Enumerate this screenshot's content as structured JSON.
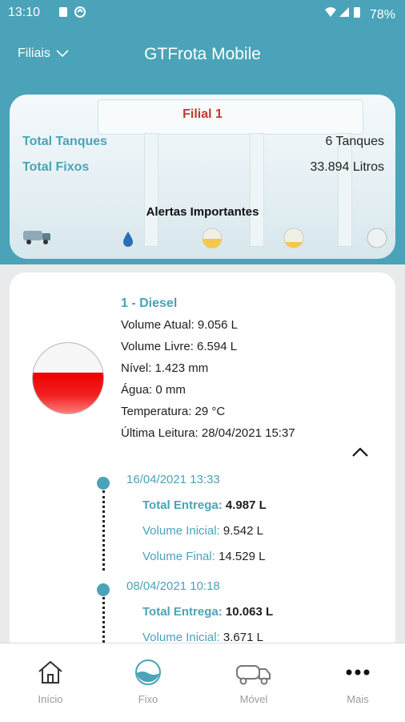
{
  "status_bar": {
    "time": "13:10",
    "battery": "78%"
  },
  "app_bar": {
    "branch_selector": "Filiais",
    "title": "GTFrota Mobile"
  },
  "summary": {
    "branch_name": "Filial 1",
    "total_tanques_label": "Total Tanques",
    "total_tanques_value": "6 Tanques",
    "total_fixos_label": "Total Fixos",
    "total_fixos_value": "33.894 Litros",
    "alerts_title": "Alertas Importantes"
  },
  "tank": {
    "name": "1 - Diesel",
    "volume_atual": "Volume Atual: 9.056 L",
    "volume_livre": "Volume Livre: 6.594 L",
    "nivel": "Nível: 1.423 mm",
    "agua": "Água: 0 mm",
    "temperatura": "Temperatura: 29 °C",
    "ultima_leitura": "Última Leitura: 28/04/2021 15:37",
    "fill_fraction": 0.58
  },
  "deliveries": [
    {
      "date": "16/04/2021 13:33",
      "total_entrega_label": "Total Entrega:",
      "total_entrega_value": "4.987 L",
      "volume_inicial_label": "Volume Inicial:",
      "volume_inicial_value": "9.542 L",
      "volume_final_label": "Volume Final:",
      "volume_final_value": "14.529 L"
    },
    {
      "date": "08/04/2021 10:18",
      "total_entrega_label": "Total Entrega:",
      "total_entrega_value": "10.063 L",
      "volume_inicial_label": "Volume Inicial:",
      "volume_inicial_value": "3.671 L"
    }
  ],
  "bottom_nav": [
    {
      "label": "Início",
      "icon": "home-icon"
    },
    {
      "label": "Fixo",
      "icon": "tank-icon"
    },
    {
      "label": "Móvel",
      "icon": "truck-icon"
    },
    {
      "label": "Mais",
      "icon": "more-icon"
    }
  ],
  "colors": {
    "accent": "#4aa3b8",
    "alert_red": "#c0392b",
    "fuel_red": "#ee1111"
  }
}
